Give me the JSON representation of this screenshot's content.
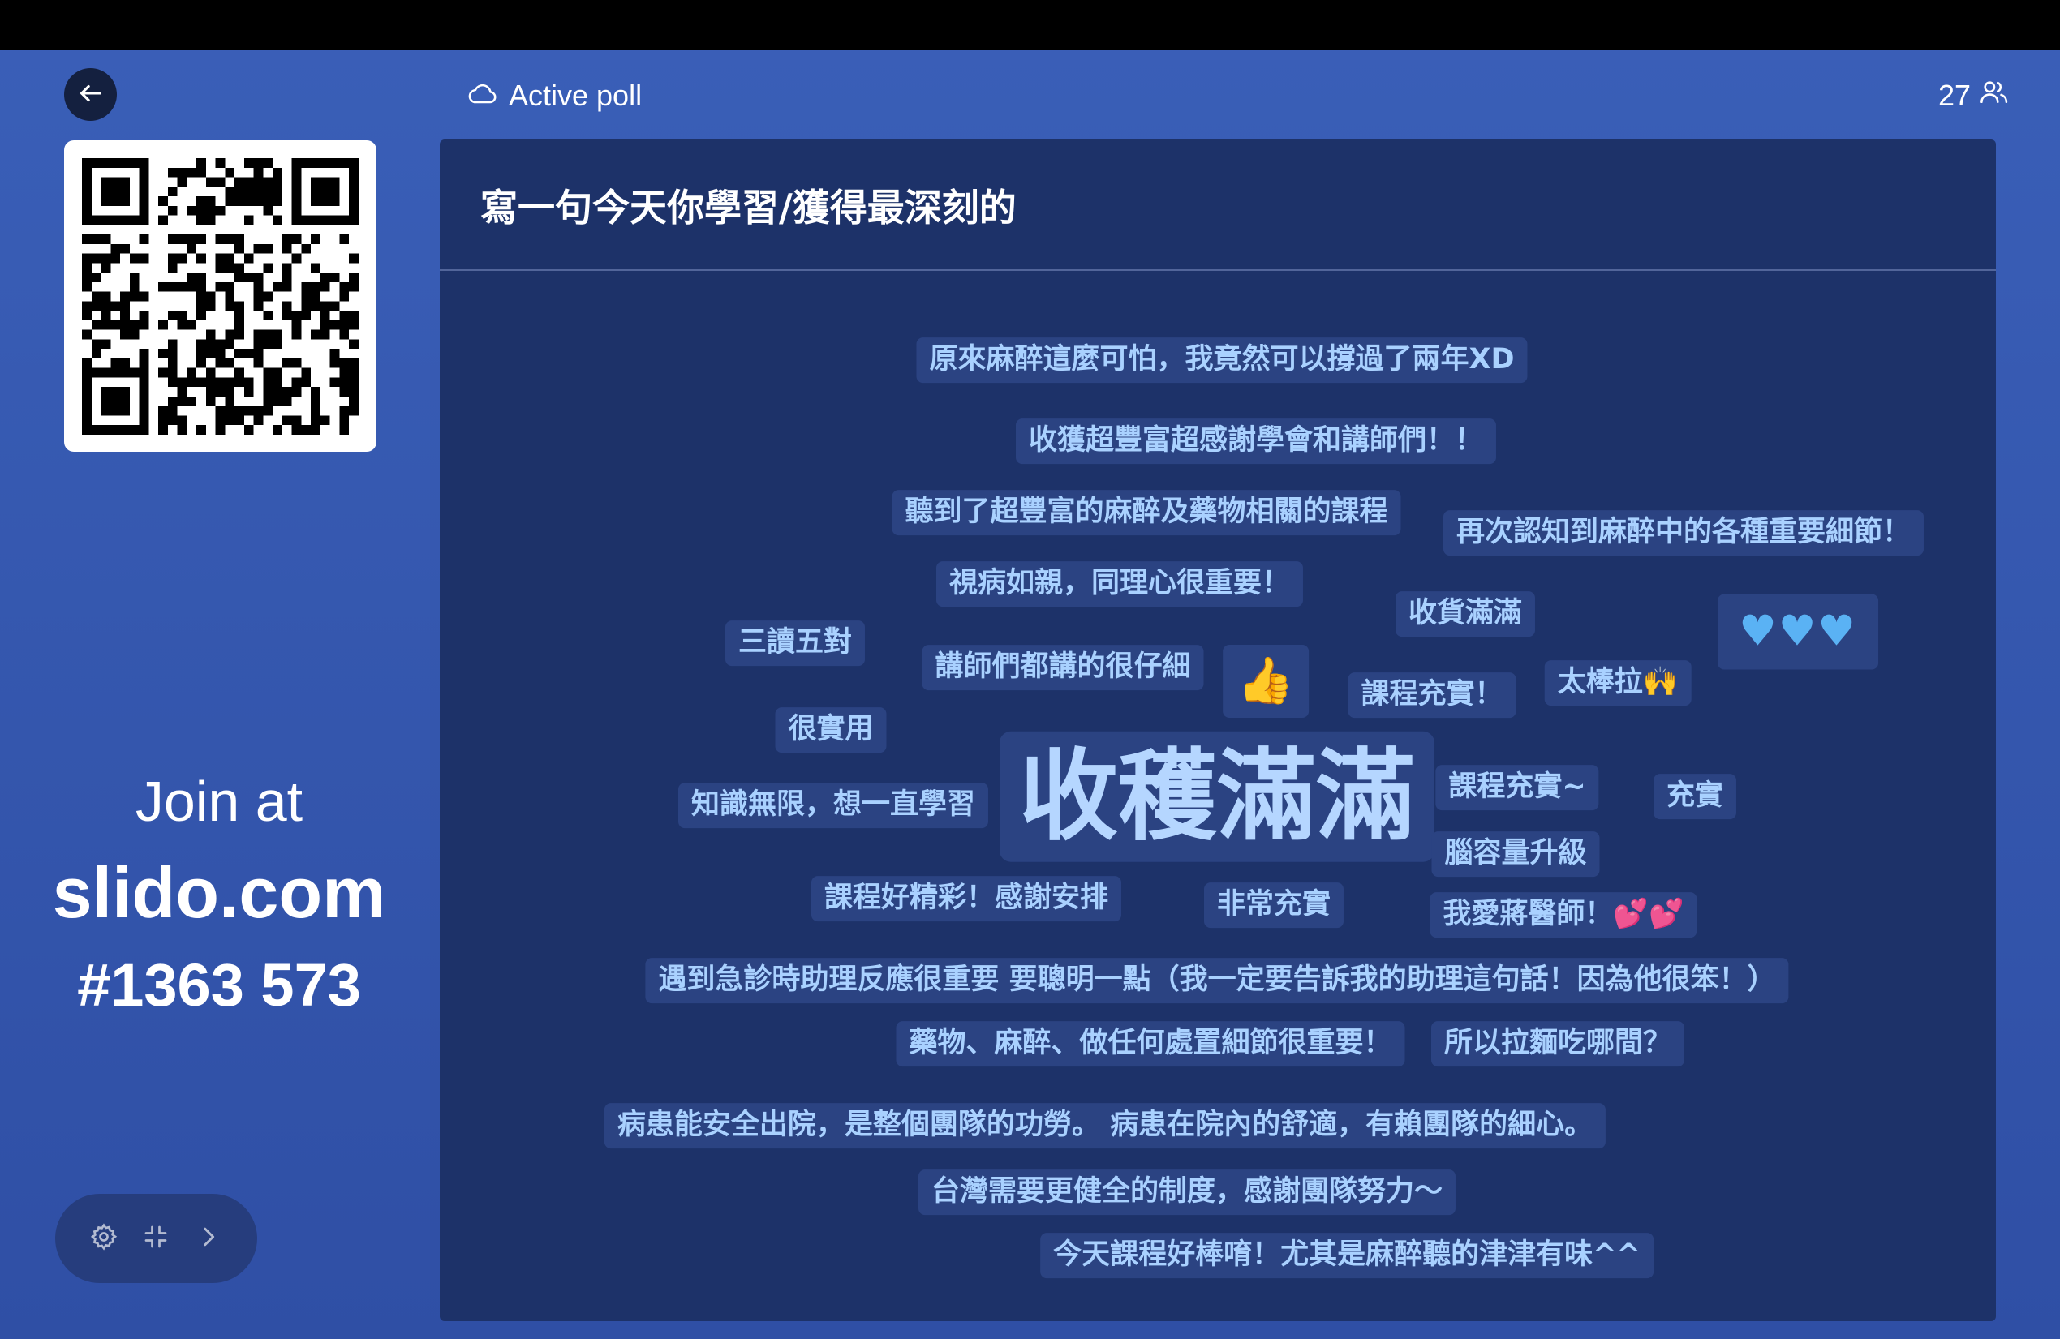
{
  "header": {
    "poll_status": "Active poll",
    "participants_count": "27"
  },
  "join": {
    "label": "Join at",
    "domain": "slido.com",
    "code": "#1363 573"
  },
  "poll": {
    "question": "寫一句今天你學習/獲得最深刻的"
  },
  "word_cloud": [
    {
      "text": "原來麻醉這麼可怕，我竟然可以撐過了兩年XD",
      "size": 35
    },
    {
      "text": "收獲超豐富超感謝學會和講師們！！",
      "size": 35
    },
    {
      "text": "聽到了超豐富的麻醉及藥物相關的課程",
      "size": 35
    },
    {
      "text": "再次認知到麻醉中的各種重要細節！",
      "size": 35
    },
    {
      "text": "視病如親，同理心很重要！",
      "size": 35
    },
    {
      "text": "收貨滿滿",
      "size": 35
    },
    {
      "text": "♥♥♥",
      "size": 52,
      "style": "hearts"
    },
    {
      "text": "三讀五對",
      "size": 35
    },
    {
      "text": "講師們都講的很仔細",
      "size": 35
    },
    {
      "text": "👍",
      "size": 56,
      "style": "emoji"
    },
    {
      "text": "課程充實！",
      "size": 35
    },
    {
      "text": "太棒拉🙌",
      "size": 35
    },
    {
      "text": "很實用",
      "size": 35
    },
    {
      "text": "收穫滿滿",
      "size": 122,
      "style": "big"
    },
    {
      "text": "課程充實~",
      "size": 35
    },
    {
      "text": "充實",
      "size": 35
    },
    {
      "text": "知識無限，想一直學習",
      "size": 35
    },
    {
      "text": "腦容量升級",
      "size": 35
    },
    {
      "text": "課程好精彩！感謝安排",
      "size": 35
    },
    {
      "text": "非常充實",
      "size": 35
    },
    {
      "text": "我愛蔣醫師！💕💕",
      "size": 35
    },
    {
      "text": "遇到急診時助理反應很重要 要聰明一點（我一定要告訴我的助理這句話！因為他很笨！）",
      "size": 35
    },
    {
      "text": "藥物、麻醉、做任何處置細節很重要！",
      "size": 35
    },
    {
      "text": "所以拉麵吃哪間？",
      "size": 35
    },
    {
      "text": "病患能安全出院，是整個團隊的功勞。 病患在院內的舒適，有賴團隊的細心。",
      "size": 35
    },
    {
      "text": "台灣需要更健全的制度，感謝團隊努力～",
      "size": 35
    },
    {
      "text": "今天課程好棒唷！尤其是麻醉聽的津津有味^^",
      "size": 35
    }
  ]
}
